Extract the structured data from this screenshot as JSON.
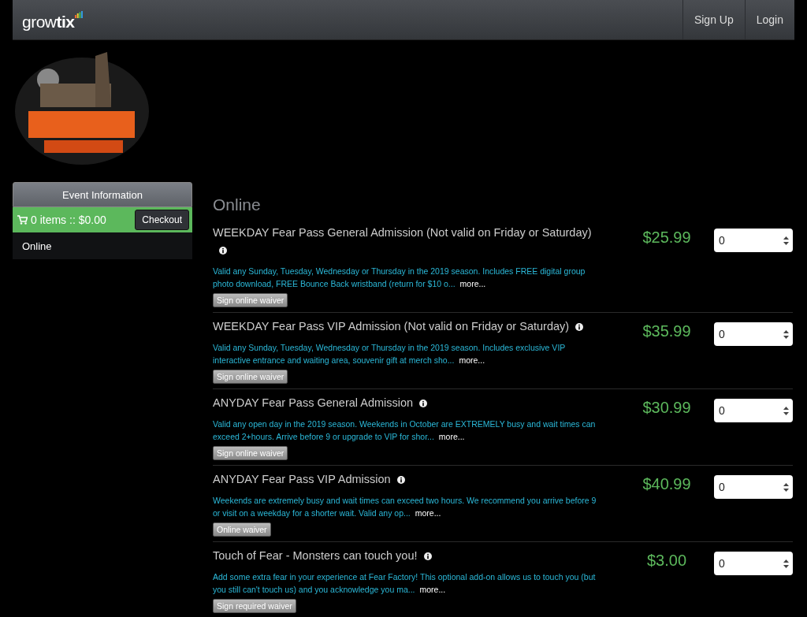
{
  "navbar": {
    "brand": "grow**tix**",
    "links": [
      {
        "label": "Sign Up"
      },
      {
        "label": "Login"
      }
    ]
  },
  "sidebar": {
    "event_info": "Event Information",
    "cart": {
      "summary": "0 items :: $0.00",
      "checkout": "Checkout"
    },
    "items": [
      {
        "label": "Online",
        "selected": true
      }
    ]
  },
  "section_title": "Online",
  "tickets": [
    {
      "title": "WEEKDAY Fear Pass General Admission (Not valid on Friday or Saturday)",
      "description": "Valid any Sunday, Tuesday, Wednesday or Thursday in the 2019 season. Includes FREE digital group photo download, FREE Bounce Back wristband (return for $10 o...",
      "more": "more...",
      "waiver": "Sign online waiver",
      "price": "$25.99",
      "quantity": "0"
    },
    {
      "title": "WEEKDAY Fear Pass VIP Admission (Not valid on Friday or Saturday)",
      "description": "Valid any Sunday, Tuesday, Wednesday or Thursday in the 2019 season. Includes exclusive VIP interactive entrance and waiting area, souvenir gift at merch sho...",
      "more": "more...",
      "waiver": "Sign online waiver",
      "price": "$35.99",
      "quantity": "0"
    },
    {
      "title": "ANYDAY Fear Pass General Admission",
      "description": "Valid any open day in the 2019 season. Weekends in October are EXTREMELY busy and wait times can exceed 2+hours. Arrive before 9 or upgrade to VIP for shor...",
      "more": "more...",
      "waiver": "Sign online waiver",
      "price": "$30.99",
      "quantity": "0"
    },
    {
      "title": "ANYDAY Fear Pass VIP Admission",
      "description": "Weekends are extremely busy and wait times can exceed two hours. We recommend you arrive before 9 or visit on a weekday for a shorter wait. Valid any op...",
      "more": "more...",
      "waiver": "Online waiver",
      "price": "$40.99",
      "quantity": "0"
    },
    {
      "title": "Touch of Fear - Monsters can touch you!",
      "description": "Add some extra fear in your experience at Fear Factory! This optional add-on allows us to touch you (but you still can't touch us) and you acknowledge you ma...",
      "more": "more...",
      "waiver": "Sign required waiver",
      "price": "$3.00",
      "quantity": "0"
    }
  ]
}
